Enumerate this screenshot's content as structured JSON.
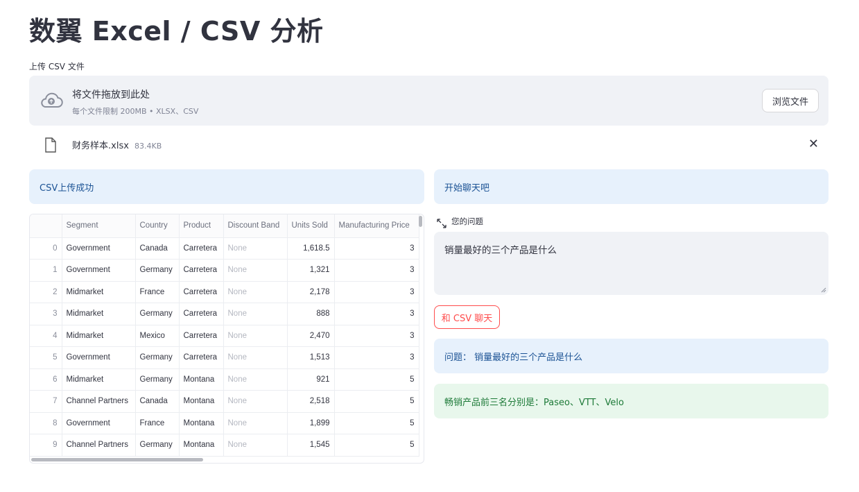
{
  "page": {
    "title": "数翼 Excel / CSV 分析"
  },
  "uploader": {
    "label": "上传 CSV 文件",
    "drop_title": "将文件拖放到此处",
    "drop_subtitle": "每个文件限制 200MB • XLSX、CSV",
    "browse_label": "浏览文件",
    "icon": "cloud-upload-icon"
  },
  "uploaded_file": {
    "name": "财务样本.xlsx",
    "size": "83.4KB",
    "icon": "file-icon"
  },
  "left_panel": {
    "status": "CSV上传成功",
    "table": {
      "columns": [
        "",
        "Segment",
        "Country",
        "Product",
        "Discount Band",
        "Units Sold",
        "Manufacturing Price"
      ],
      "rows": [
        [
          "0",
          "Government",
          "Canada",
          "Carretera",
          "None",
          "1,618.5",
          "3"
        ],
        [
          "1",
          "Government",
          "Germany",
          "Carretera",
          "None",
          "1,321",
          "3"
        ],
        [
          "2",
          "Midmarket",
          "France",
          "Carretera",
          "None",
          "2,178",
          "3"
        ],
        [
          "3",
          "Midmarket",
          "Germany",
          "Carretera",
          "None",
          "888",
          "3"
        ],
        [
          "4",
          "Midmarket",
          "Mexico",
          "Carretera",
          "None",
          "2,470",
          "3"
        ],
        [
          "5",
          "Government",
          "Germany",
          "Carretera",
          "None",
          "1,513",
          "3"
        ],
        [
          "6",
          "Midmarket",
          "Germany",
          "Montana",
          "None",
          "921",
          "5"
        ],
        [
          "7",
          "Channel Partners",
          "Canada",
          "Montana",
          "None",
          "2,518",
          "5"
        ],
        [
          "8",
          "Government",
          "France",
          "Montana",
          "None",
          "1,899",
          "5"
        ],
        [
          "9",
          "Channel Partners",
          "Germany",
          "Montana",
          "None",
          "1,545",
          "5"
        ]
      ]
    }
  },
  "right_panel": {
    "header": "开始聊天吧",
    "question_label": "您的问题",
    "question_value": "销量最好的三个产品是什么",
    "chat_button": "和 CSV 聊天",
    "question_echo": "问题： 销量最好的三个产品是什么",
    "answer": "畅销产品前三名分别是：Paseo、VTT、Velo"
  },
  "colors": {
    "accent": "#ff4b4b",
    "info_bg": "#e7f1fc",
    "info_text": "#1b5294",
    "success_bg": "#e8f7ec",
    "success_text": "#1d7a38"
  }
}
